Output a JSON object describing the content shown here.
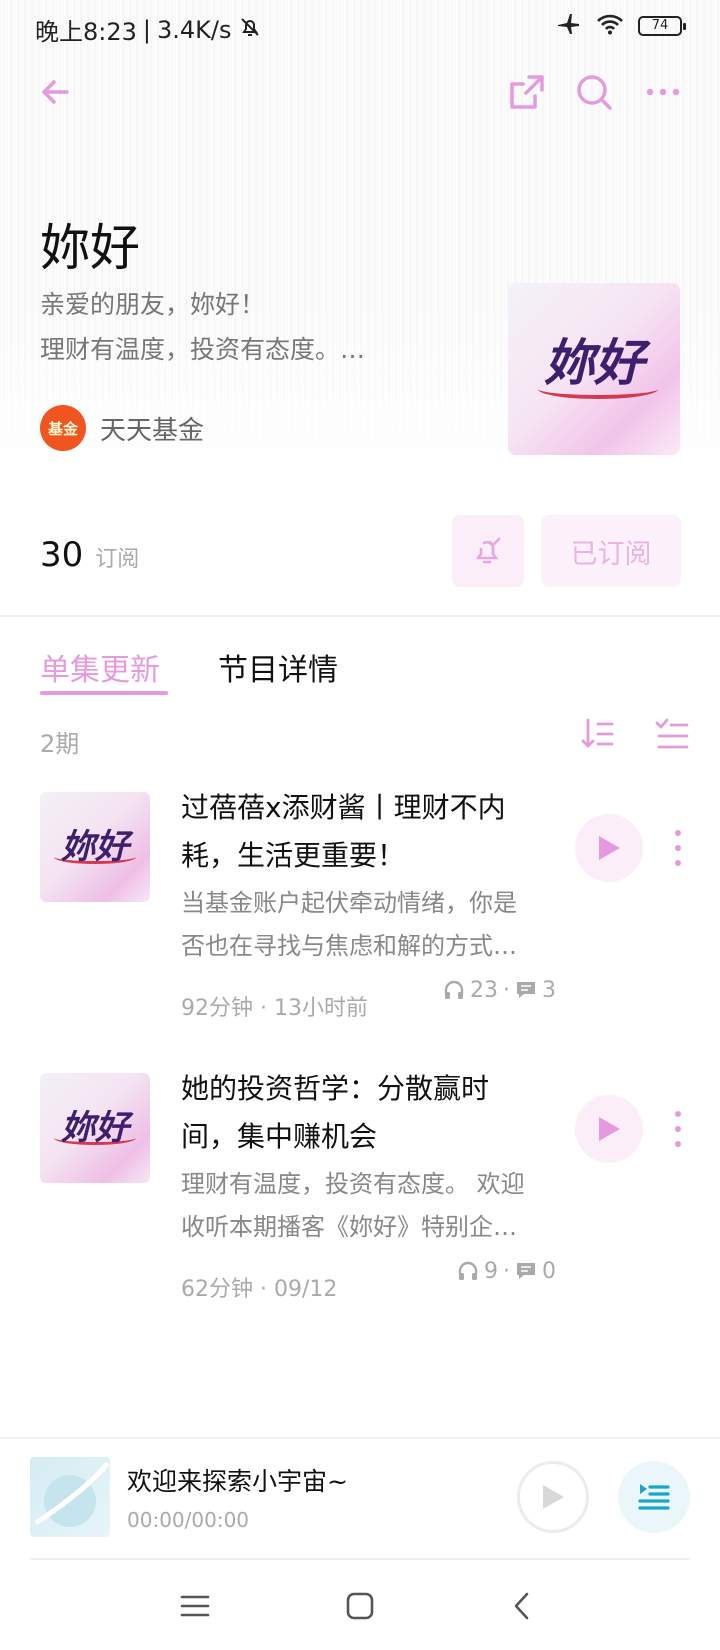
{
  "status_bar": {
    "time": "晚上8:23",
    "separator": "|",
    "network_speed": "3.4K/s",
    "battery": "74"
  },
  "nav": {
    "back_icon": "arrow-left-icon",
    "share_icon": "share-external-icon",
    "search_icon": "search-icon",
    "more_icon": "more-horizontal-icon"
  },
  "podcast": {
    "title": "妳好",
    "description_line1": "亲爱的朋友，妳好！",
    "description_line2": "理财有温度，投资有态度。…",
    "author": "天天基金",
    "author_logo_text": "基金",
    "cover_text": "妳好",
    "subscriber_count": "30",
    "subscriber_label": "订阅",
    "subscribed_label": "已订阅"
  },
  "tabs": [
    {
      "label": "单集更新",
      "active": true
    },
    {
      "label": "节目详情",
      "active": false
    }
  ],
  "episode_count": "2期",
  "episodes": [
    {
      "cover_text": "妳好",
      "title": "过蓓蓓x添财酱丨理财不内耗，生活更重要！",
      "desc_line1": "当基金账户起伏牵动情绪，你是",
      "desc_line2": "否也在寻找与焦虑和解的方式…",
      "duration": "92分钟",
      "dot": "·",
      "published": "13小时前",
      "plays": "23",
      "comments": "3"
    },
    {
      "cover_text": "妳好",
      "title": "她的投资哲学：分散赢时间，集中赚机会",
      "desc_line1": "理财有温度，投资有态度。 欢迎",
      "desc_line2": "收听本期播客《妳好》特别企…",
      "duration": "62分钟",
      "dot": "·",
      "published": "09/12",
      "plays": "9",
      "comments": "0"
    }
  ],
  "player": {
    "title": "欢迎来探索小宇宙~",
    "time": "00:00/00:00"
  },
  "colors": {
    "accent_pink": "#e59ae0",
    "accent_bg": "#fbeef9",
    "player_list_icon": "#1aa6c8"
  }
}
